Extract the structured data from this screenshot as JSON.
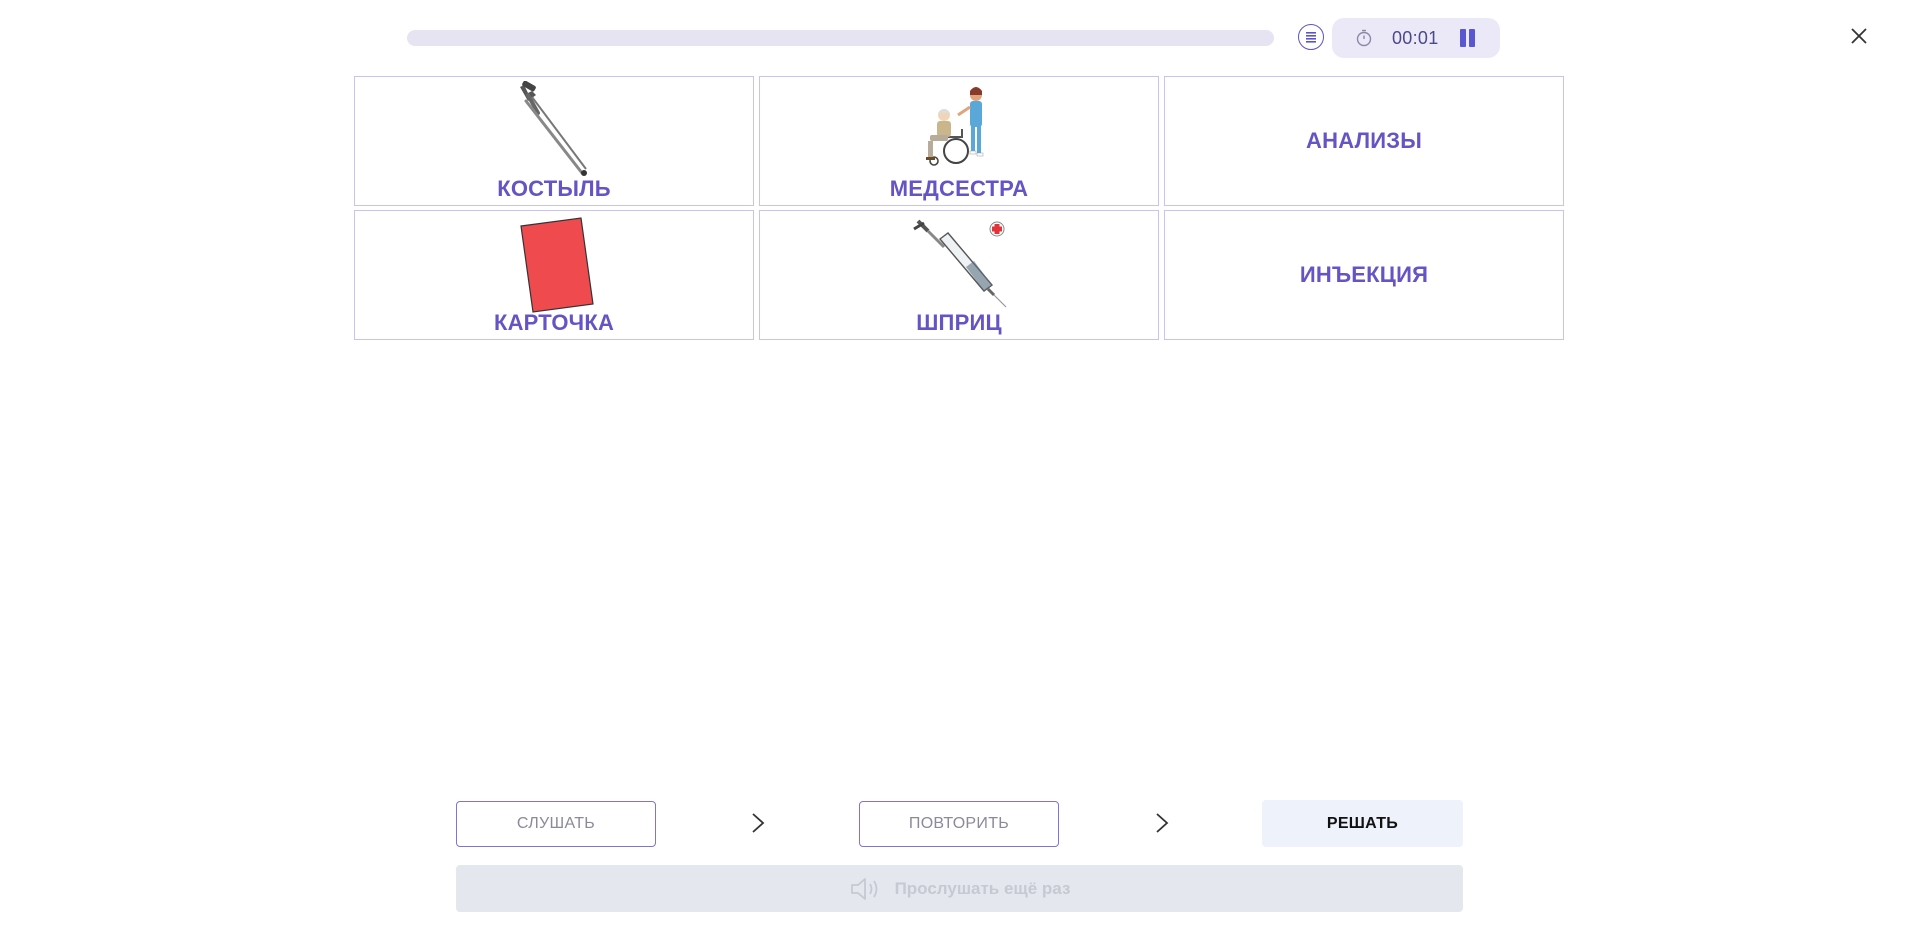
{
  "header": {
    "progress": 0,
    "timer": "00:01",
    "icons": {
      "list": "list-icon",
      "stopwatch": "stopwatch-icon",
      "pause": "pause-icon",
      "close": "close-icon"
    }
  },
  "cards": [
    {
      "label": "КОСТЫЛЬ",
      "image": "crutch-image"
    },
    {
      "label": "МЕДСЕСТРА",
      "image": "nurse-wheelchair-image"
    },
    {
      "label": "АНАЛИЗЫ",
      "image": ""
    },
    {
      "label": "КАРТОЧКА",
      "image": "card-image"
    },
    {
      "label": "ШПРИЦ",
      "image": "syringe-image"
    },
    {
      "label": "ИНЪЕКЦИЯ",
      "image": ""
    }
  ],
  "controls": {
    "listen_label": "СЛУШАТЬ",
    "repeat_label": "ПОВТОРИТЬ",
    "solve_label": "РЕШАТЬ",
    "relisten_label": "Прослушать ещё раз"
  },
  "colors": {
    "accent": "#6654c4",
    "card_border": "#c9c3ee",
    "progress_track": "#e6e4f2",
    "disabled_bg": "#e4e7ee"
  }
}
